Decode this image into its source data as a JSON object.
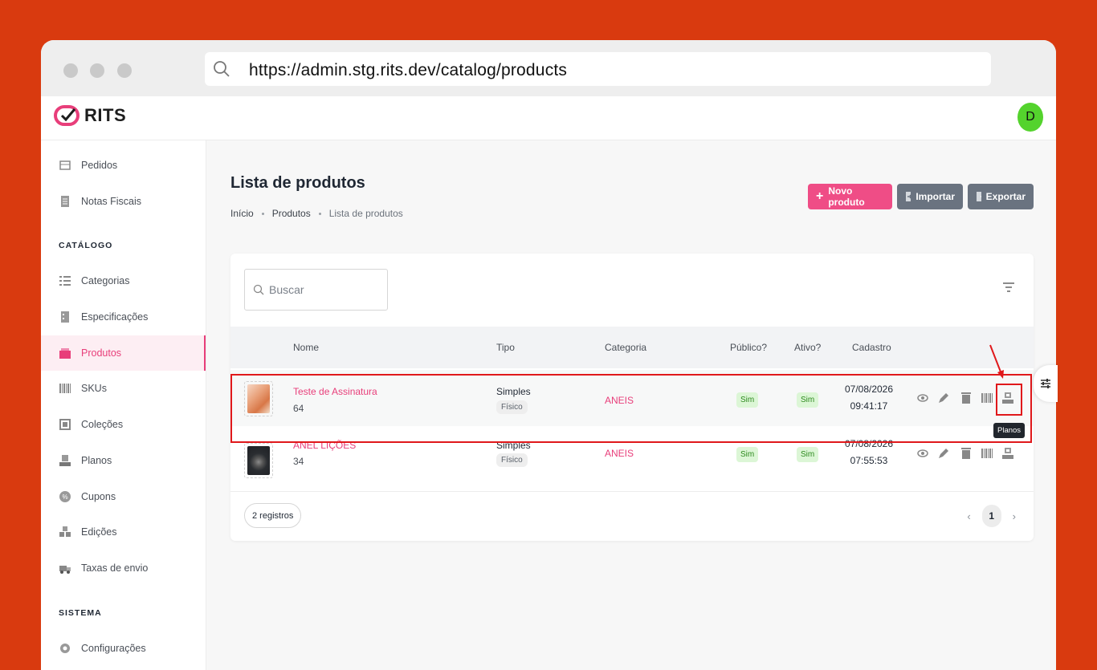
{
  "browser": {
    "url": "https://admin.stg.rits.dev/catalog/products"
  },
  "app": {
    "logo_text": "RITS",
    "avatar_initial": "D"
  },
  "sidebar": {
    "items_top": [
      {
        "label": "Pedidos",
        "icon": "orders-icon"
      },
      {
        "label": "Notas Fiscais",
        "icon": "invoice-icon"
      }
    ],
    "catalog_header": "CATÁLOGO",
    "catalog_items": [
      {
        "label": "Categorias",
        "icon": "list-icon"
      },
      {
        "label": "Especificações",
        "icon": "specs-icon"
      },
      {
        "label": "Produtos",
        "icon": "box-icon",
        "active": true
      },
      {
        "label": "SKUs",
        "icon": "barcode-icon"
      },
      {
        "label": "Coleções",
        "icon": "collection-icon"
      },
      {
        "label": "Planos",
        "icon": "plan-icon"
      },
      {
        "label": "Cupons",
        "icon": "coupon-icon"
      },
      {
        "label": "Edições",
        "icon": "editions-icon"
      },
      {
        "label": "Taxas de envio",
        "icon": "shipping-icon"
      }
    ],
    "system_header": "SISTEMA",
    "system_items": [
      {
        "label": "Configurações",
        "icon": "gear-icon"
      }
    ]
  },
  "page": {
    "title": "Lista de produtos",
    "breadcrumb": [
      "Início",
      "Produtos",
      "Lista de produtos"
    ],
    "buttons": {
      "new": "Novo produto",
      "import": "Importar",
      "export": "Exportar"
    }
  },
  "search": {
    "placeholder": "Buscar"
  },
  "table": {
    "columns": [
      "Nome",
      "Tipo",
      "Categoria",
      "Público?",
      "Ativo?",
      "Cadastro"
    ],
    "rows": [
      {
        "name": "Teste de Assinatura",
        "code": "64",
        "type": "Simples",
        "tag": "Físico",
        "category": "ANEIS",
        "public": "Sim",
        "active": "Sim",
        "date": "07/08/2026",
        "time": "09:41:17"
      },
      {
        "name": "ANEL LIÇÕES",
        "code": "34",
        "type": "Simples",
        "tag": "Físico",
        "category": "ANEIS",
        "public": "Sim",
        "active": "Sim",
        "date": "07/08/2026",
        "time": "07:55:53"
      }
    ]
  },
  "footer": {
    "count": "2 registros",
    "page": "1"
  },
  "tooltip": "Planos",
  "colors": {
    "accent": "#ef4d86",
    "highlight": "#e0181b",
    "background": "#d93a0f",
    "avatar": "#54d32d"
  }
}
